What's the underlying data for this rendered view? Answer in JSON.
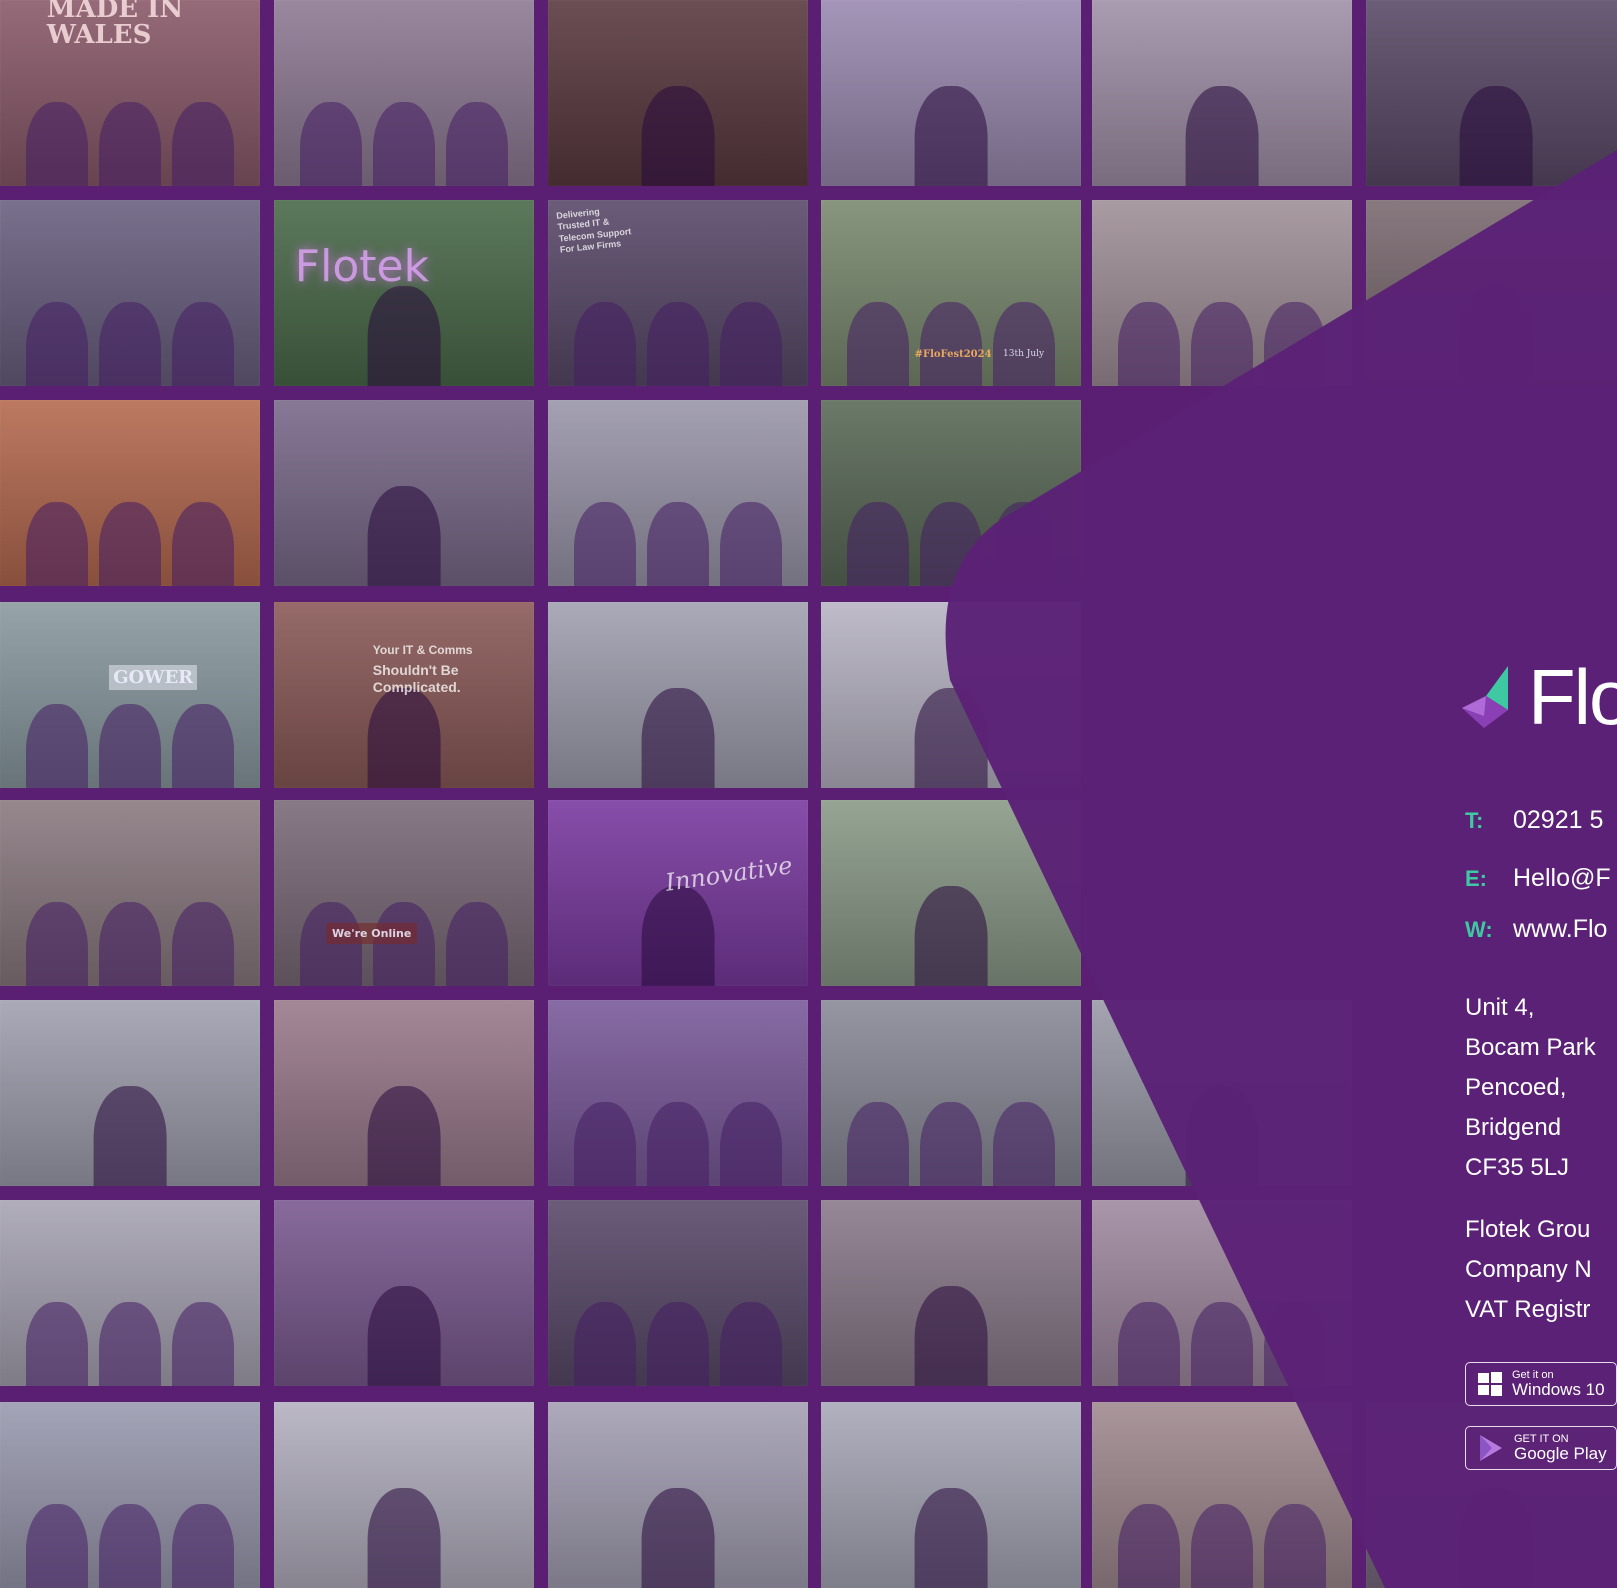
{
  "colors": {
    "background": "#5a1f72",
    "panel": "#5b2176",
    "accent_teal": "#3fc9a3",
    "accent_purple": "#8b3fb5",
    "text": "#ffffff"
  },
  "brand": {
    "wordmark": "Flo"
  },
  "contact": {
    "phone_key": "T:",
    "phone_value": "02921 5",
    "email_key": "E:",
    "email_value": "Hello@F",
    "web_key": "W:",
    "web_value": "www.Flo"
  },
  "address": [
    "Unit 4,",
    "Bocam Park",
    "Pencoed,",
    "Bridgend",
    "CF35 5LJ"
  ],
  "company": [
    "Flotek Grou",
    "Company N",
    "VAT Registr"
  ],
  "badges": {
    "windows_small": "Get it on",
    "windows_big": "Windows 10",
    "google_small": "GET IT ON",
    "google_big": "Google Play"
  },
  "photo_texts": {
    "award_sign": "MADE IN\nWALES",
    "neon_sign": "Flotek",
    "banner_text": "Your IT & Comms",
    "banner_accent": "Shouldn't Be\nComplicated.",
    "script_word": "Innovative",
    "gower_sign": "GOWER",
    "flofest_caption": "#FloFest2024",
    "flofest_date": "13th July",
    "online_sign": "We're Online",
    "stand_text": "Delivering\nTrusted IT &\nTelecom Support\nFor Law Firms"
  },
  "tiles": [
    {
      "c": 0,
      "r": 0,
      "bg": "#8a5a6a",
      "kind": "award"
    },
    {
      "c": 1,
      "r": 0,
      "bg": "#8e7a94",
      "kind": "group"
    },
    {
      "c": 2,
      "r": 0,
      "bg": "#5a3a40",
      "kind": "single"
    },
    {
      "c": 3,
      "r": 0,
      "bg": "#9a8ab0",
      "kind": "single"
    },
    {
      "c": 4,
      "r": 0,
      "bg": "#a090a8",
      "kind": "single"
    },
    {
      "c": 5,
      "r": 0,
      "bg": "#5b4a68",
      "kind": "single"
    },
    {
      "c": 0,
      "r": 1,
      "bg": "#6a6080",
      "kind": "group"
    },
    {
      "c": 1,
      "r": 1,
      "bg": "#4a6a4a",
      "kind": "neon"
    },
    {
      "c": 2,
      "r": 1,
      "bg": "#5a4a6a",
      "kind": "stand"
    },
    {
      "c": 3,
      "r": 1,
      "bg": "#7a8a70",
      "kind": "flofest"
    },
    {
      "c": 4,
      "r": 1,
      "bg": "#a09098",
      "kind": "group"
    },
    {
      "c": 5,
      "r": 1,
      "bg": "#7a6a70",
      "kind": "single"
    },
    {
      "c": 0,
      "r": 2,
      "bg": "#b56a50",
      "kind": "group"
    },
    {
      "c": 1,
      "r": 2,
      "bg": "#7a6a8a",
      "kind": "single"
    },
    {
      "c": 2,
      "r": 2,
      "bg": "#9a96aa",
      "kind": "group"
    },
    {
      "c": 3,
      "r": 2,
      "bg": "#5a6a58",
      "kind": "group"
    },
    {
      "c": 0,
      "r": 3,
      "bg": "#8a9aa0",
      "kind": "gower"
    },
    {
      "c": 1,
      "r": 3,
      "bg": "#8a5a58",
      "kind": "banner"
    },
    {
      "c": 2,
      "r": 3,
      "bg": "#a0a0b0",
      "kind": "single"
    },
    {
      "c": 3,
      "r": 3,
      "bg": "#b8b4c4",
      "kind": "single"
    },
    {
      "c": 0,
      "r": 4,
      "bg": "#8a7a80",
      "kind": "group"
    },
    {
      "c": 1,
      "r": 4,
      "bg": "#7a6a78",
      "kind": "online"
    },
    {
      "c": 2,
      "r": 4,
      "bg": "#7a3aa0",
      "kind": "script"
    },
    {
      "c": 3,
      "r": 4,
      "bg": "#8a9a88",
      "kind": "single"
    },
    {
      "c": 0,
      "r": 5,
      "bg": "#a0a0b0",
      "kind": "single"
    },
    {
      "c": 1,
      "r": 5,
      "bg": "#9a7a8c",
      "kind": "single"
    },
    {
      "c": 2,
      "r": 5,
      "bg": "#7a5a9a",
      "kind": "group"
    },
    {
      "c": 3,
      "r": 5,
      "bg": "#8a8a98",
      "kind": "group"
    },
    {
      "c": 4,
      "r": 5,
      "bg": "#9a9aa8",
      "kind": "single"
    },
    {
      "c": 0,
      "r": 6,
      "bg": "#a8a4b4",
      "kind": "group"
    },
    {
      "c": 1,
      "r": 6,
      "bg": "#7a5a90",
      "kind": "single"
    },
    {
      "c": 2,
      "r": 6,
      "bg": "#5a4a6a",
      "kind": "group"
    },
    {
      "c": 3,
      "r": 6,
      "bg": "#8a7a8a",
      "kind": "single"
    },
    {
      "c": 4,
      "r": 6,
      "bg": "#a08aa0",
      "kind": "group"
    },
    {
      "c": 0,
      "r": 7,
      "bg": "#9a9ab0",
      "kind": "group"
    },
    {
      "c": 1,
      "r": 7,
      "bg": "#b4b0c0",
      "kind": "single"
    },
    {
      "c": 2,
      "r": 7,
      "bg": "#a4a0b4",
      "kind": "single"
    },
    {
      "c": 3,
      "r": 7,
      "bg": "#a8a8b8",
      "kind": "single"
    },
    {
      "c": 4,
      "r": 7,
      "bg": "#a08a90",
      "kind": "group"
    },
    {
      "c": 5,
      "r": 7,
      "bg": "#7a6a80",
      "kind": "single"
    }
  ]
}
